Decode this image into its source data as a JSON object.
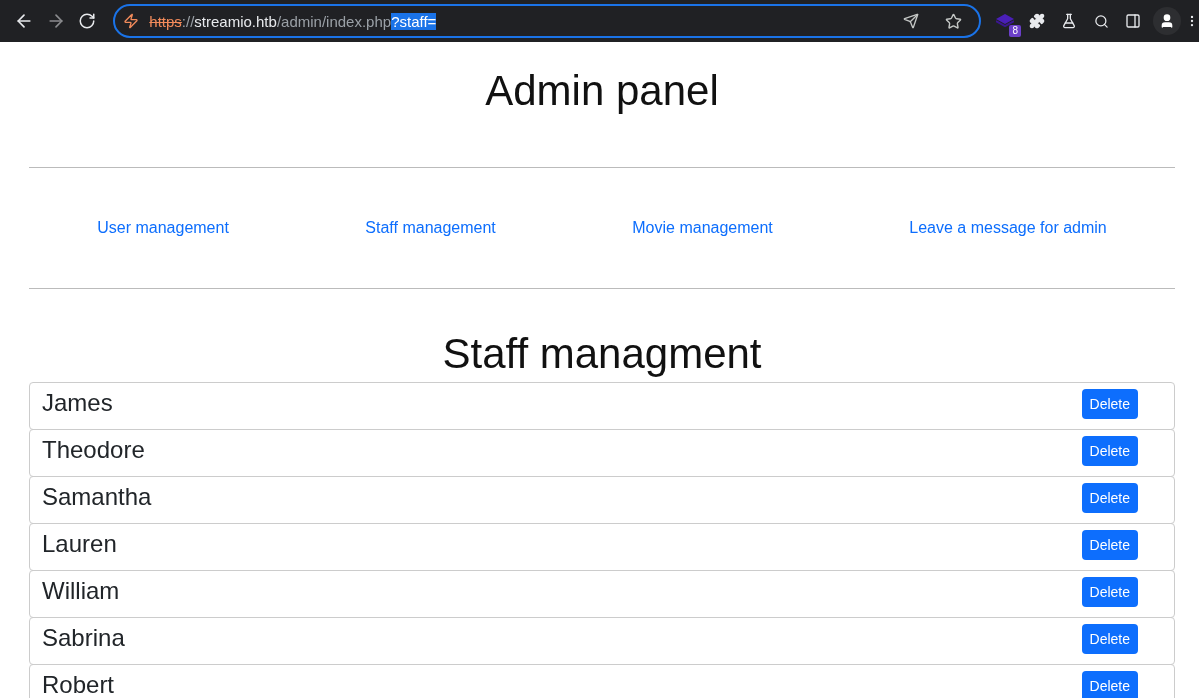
{
  "browser": {
    "url": {
      "scheme": "https",
      "separator": "://",
      "host": "streamio.htb",
      "path": "/admin/index.php",
      "selected_query": "?staff="
    },
    "extension_badge": "8",
    "back_disabled": false,
    "forward_disabled": true
  },
  "page": {
    "title": "Admin panel",
    "nav_links": [
      "User management",
      "Staff management",
      "Movie management",
      "Leave a message for admin"
    ],
    "section_title": "Staff managment",
    "staff": [
      {
        "name": "James",
        "action": "Delete"
      },
      {
        "name": "Theodore",
        "action": "Delete"
      },
      {
        "name": "Samantha",
        "action": "Delete"
      },
      {
        "name": "Lauren",
        "action": "Delete"
      },
      {
        "name": "William",
        "action": "Delete"
      },
      {
        "name": "Sabrina",
        "action": "Delete"
      },
      {
        "name": "Robert",
        "action": "Delete"
      }
    ]
  }
}
